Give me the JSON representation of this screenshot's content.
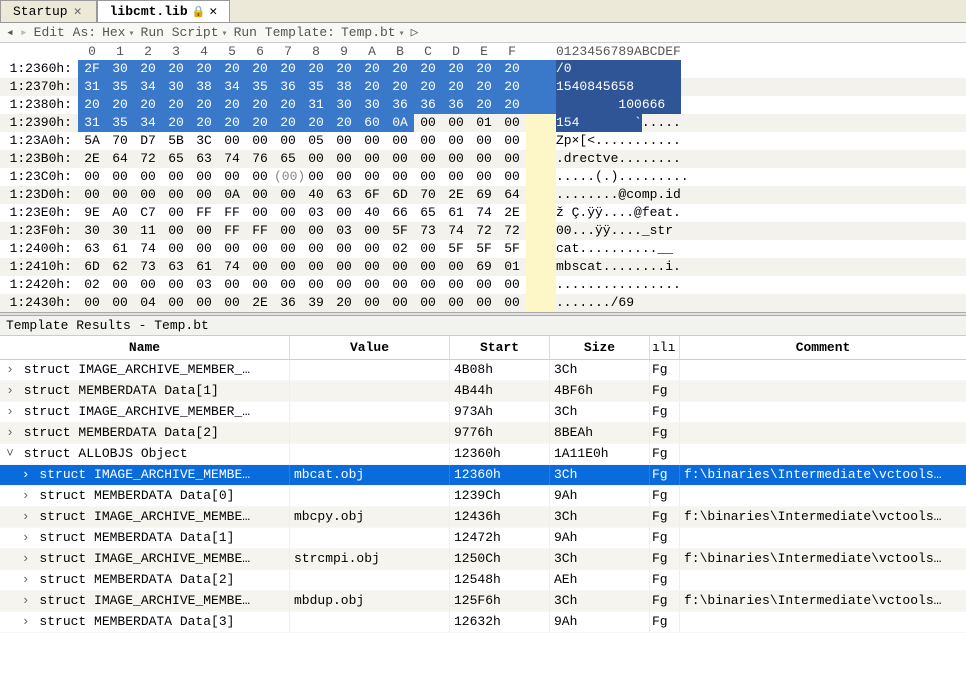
{
  "tabs": {
    "t0": "Startup",
    "t1": "libcmt.lib",
    "locked_marker": "🔒 ✕"
  },
  "toolbar": {
    "edit_as": "Edit As:",
    "hex": "Hex",
    "run_script": "Run Script",
    "run_template": "Run Template:",
    "tpl": "Temp.bt"
  },
  "hex": {
    "col_labels": [
      "0",
      "1",
      "2",
      "3",
      "4",
      "5",
      "6",
      "7",
      "8",
      "9",
      "A",
      "B",
      "C",
      "D",
      "E",
      "F"
    ],
    "ascii_hdr": "0123456789ABCDEF",
    "rows": [
      {
        "addr": "1:2360h:",
        "bytes": [
          "2F",
          "30",
          "20",
          "20",
          "20",
          "20",
          "20",
          "20",
          "20",
          "20",
          "20",
          "20",
          "20",
          "20",
          "20",
          "20"
        ],
        "sel": [
          0,
          16
        ],
        "asc": "/0              ",
        "asc_sel": [
          0,
          16
        ]
      },
      {
        "addr": "1:2370h:",
        "bytes": [
          "31",
          "35",
          "34",
          "30",
          "38",
          "34",
          "35",
          "36",
          "35",
          "38",
          "20",
          "20",
          "20",
          "20",
          "20",
          "20"
        ],
        "sel": [
          0,
          16
        ],
        "asc": "1540845658      ",
        "asc_sel": [
          0,
          16
        ]
      },
      {
        "addr": "1:2380h:",
        "bytes": [
          "20",
          "20",
          "20",
          "20",
          "20",
          "20",
          "20",
          "20",
          "31",
          "30",
          "30",
          "36",
          "36",
          "36",
          "20",
          "20"
        ],
        "sel": [
          0,
          16
        ],
        "asc": "        100666  ",
        "asc_sel": [
          0,
          16
        ]
      },
      {
        "addr": "1:2390h:",
        "bytes": [
          "31",
          "35",
          "34",
          "20",
          "20",
          "20",
          "20",
          "20",
          "20",
          "20",
          "60",
          "0A",
          "00",
          "00",
          "01",
          "00"
        ],
        "sel": [
          0,
          12
        ],
        "asc": "154       `.....",
        "asc_sel": [
          0,
          11
        ]
      },
      {
        "addr": "1:23A0h:",
        "bytes": [
          "5A",
          "70",
          "D7",
          "5B",
          "3C",
          "00",
          "00",
          "00",
          "05",
          "00",
          "00",
          "00",
          "00",
          "00",
          "00",
          "00"
        ],
        "asc": "Zp×[<..........."
      },
      {
        "addr": "1:23B0h:",
        "bytes": [
          "2E",
          "64",
          "72",
          "65",
          "63",
          "74",
          "76",
          "65",
          "00",
          "00",
          "00",
          "00",
          "00",
          "00",
          "00",
          "00"
        ],
        "asc": ".drectve........"
      },
      {
        "addr": "1:23C0h:",
        "bytes": [
          "00",
          "00",
          "00",
          "00",
          "00",
          "00",
          "00",
          "(00)",
          "00",
          "00",
          "00",
          "00",
          "00",
          "00",
          "00",
          "00"
        ],
        "asc": ".....(.).........",
        "paren": 7
      },
      {
        "addr": "1:23D0h:",
        "bytes": [
          "00",
          "00",
          "00",
          "00",
          "00",
          "0A",
          "00",
          "00",
          "40",
          "63",
          "6F",
          "6D",
          "70",
          "2E",
          "69",
          "64"
        ],
        "asc": "........@comp.id"
      },
      {
        "addr": "1:23E0h:",
        "bytes": [
          "9E",
          "A0",
          "C7",
          "00",
          "FF",
          "FF",
          "00",
          "00",
          "03",
          "00",
          "40",
          "66",
          "65",
          "61",
          "74",
          "2E"
        ],
        "asc": "ž Ç.ÿÿ....@feat."
      },
      {
        "addr": "1:23F0h:",
        "bytes": [
          "30",
          "30",
          "11",
          "00",
          "00",
          "FF",
          "FF",
          "00",
          "00",
          "03",
          "00",
          "5F",
          "73",
          "74",
          "72",
          "72"
        ],
        "asc": "00...ÿÿ...._str"
      },
      {
        "addr": "1:2400h:",
        "bytes": [
          "63",
          "61",
          "74",
          "00",
          "00",
          "00",
          "00",
          "00",
          "00",
          "00",
          "00",
          "02",
          "00",
          "5F",
          "5F",
          "5F"
        ],
        "asc": "cat..........__"
      },
      {
        "addr": "1:2410h:",
        "bytes": [
          "6D",
          "62",
          "73",
          "63",
          "61",
          "74",
          "00",
          "00",
          "00",
          "00",
          "00",
          "00",
          "00",
          "00",
          "69",
          "01"
        ],
        "asc": "mbscat........i."
      },
      {
        "addr": "1:2420h:",
        "bytes": [
          "02",
          "00",
          "00",
          "00",
          "03",
          "00",
          "00",
          "00",
          "00",
          "00",
          "00",
          "00",
          "00",
          "00",
          "00",
          "00"
        ],
        "asc": "................"
      },
      {
        "addr": "1:2430h:",
        "bytes": [
          "00",
          "00",
          "04",
          "00",
          "00",
          "00",
          "2E",
          "36",
          "39",
          "20",
          "00",
          "00",
          "00",
          "00",
          "00",
          "00"
        ],
        "asc": "......./69"
      }
    ]
  },
  "template_results": {
    "title": "Template Results - Temp.bt",
    "cols": {
      "name": "Name",
      "value": "Value",
      "start": "Start",
      "size": "Size",
      "fg": "ılı",
      "comment": "Comment"
    },
    "rows": [
      {
        "ind": 0,
        "ex": ">",
        "name": "struct IMAGE_ARCHIVE_MEMBER_…",
        "val": "",
        "start": "4B08h",
        "size": "3Ch",
        "fg": "Fg",
        "cm": ""
      },
      {
        "ind": 0,
        "ex": ">",
        "name": "struct MEMBERDATA Data[1]",
        "val": "",
        "start": "4B44h",
        "size": "4BF6h",
        "fg": "Fg",
        "cm": ""
      },
      {
        "ind": 0,
        "ex": ">",
        "name": "struct IMAGE_ARCHIVE_MEMBER_…",
        "val": "",
        "start": "973Ah",
        "size": "3Ch",
        "fg": "Fg",
        "cm": ""
      },
      {
        "ind": 0,
        "ex": ">",
        "name": "struct MEMBERDATA Data[2]",
        "val": "",
        "start": "9776h",
        "size": "8BEAh",
        "fg": "Fg",
        "cm": ""
      },
      {
        "ind": 0,
        "ex": "v",
        "name": "struct ALLOBJS Object",
        "val": "",
        "start": "12360h",
        "size": "1A11E0h",
        "fg": "Fg",
        "cm": ""
      },
      {
        "ind": 1,
        "ex": ">",
        "name": "struct IMAGE_ARCHIVE_MEMBE…",
        "val": "mbcat.obj",
        "start": "12360h",
        "size": "3Ch",
        "fg": "Fg",
        "cm": "f:\\binaries\\Intermediate\\vctools…",
        "sel": true
      },
      {
        "ind": 1,
        "ex": ">",
        "name": "struct MEMBERDATA Data[0]",
        "val": "",
        "start": "1239Ch",
        "size": "9Ah",
        "fg": "Fg",
        "cm": ""
      },
      {
        "ind": 1,
        "ex": ">",
        "name": "struct IMAGE_ARCHIVE_MEMBE…",
        "val": "mbcpy.obj",
        "start": "12436h",
        "size": "3Ch",
        "fg": "Fg",
        "cm": "f:\\binaries\\Intermediate\\vctools…"
      },
      {
        "ind": 1,
        "ex": ">",
        "name": "struct MEMBERDATA Data[1]",
        "val": "",
        "start": "12472h",
        "size": "9Ah",
        "fg": "Fg",
        "cm": ""
      },
      {
        "ind": 1,
        "ex": ">",
        "name": "struct IMAGE_ARCHIVE_MEMBE…",
        "val": "strcmpi.obj",
        "start": "1250Ch",
        "size": "3Ch",
        "fg": "Fg",
        "cm": "f:\\binaries\\Intermediate\\vctools…"
      },
      {
        "ind": 1,
        "ex": ">",
        "name": "struct MEMBERDATA Data[2]",
        "val": "",
        "start": "12548h",
        "size": "AEh",
        "fg": "Fg",
        "cm": ""
      },
      {
        "ind": 1,
        "ex": ">",
        "name": "struct IMAGE_ARCHIVE_MEMBE…",
        "val": "mbdup.obj",
        "start": "125F6h",
        "size": "3Ch",
        "fg": "Fg",
        "cm": "f:\\binaries\\Intermediate\\vctools…"
      },
      {
        "ind": 1,
        "ex": ">",
        "name": "struct MEMBERDATA Data[3]",
        "val": "",
        "start": "12632h",
        "size": "9Ah",
        "fg": "Fg",
        "cm": ""
      }
    ]
  }
}
